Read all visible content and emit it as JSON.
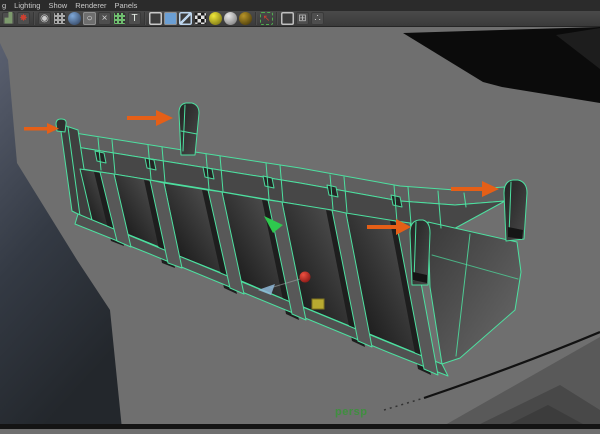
{
  "menu_bar": {
    "items": [
      {
        "label": "g"
      },
      {
        "label": "Lighting"
      },
      {
        "label": "Show"
      },
      {
        "label": "Renderer"
      },
      {
        "label": "Panels"
      }
    ]
  },
  "toolbar": {
    "icons": [
      {
        "name": "partial-toolbar-icon",
        "type": "glyph",
        "glyph": "▟",
        "fg": "#7d9a6d"
      },
      {
        "name": "snap-red-icon",
        "type": "glyph",
        "glyph": "✸",
        "fg": "#cf4030"
      },
      {
        "name": "separator",
        "type": "sep"
      },
      {
        "name": "resolution-gate-eye-icon",
        "type": "glyph",
        "glyph": "◉",
        "fg": "#cccccc"
      },
      {
        "name": "film-gate-icon",
        "type": "grid",
        "fg": "#aaaaaa"
      },
      {
        "name": "camera-sphere-icon",
        "type": "sphere",
        "fg": "#7fa8d8",
        "bg": "#2a3a55"
      },
      {
        "name": "gate-mask-icon",
        "type": "glyph",
        "glyph": "○",
        "fg": "#e0e0e0",
        "active": true
      },
      {
        "name": "field-chart-icon",
        "type": "glyph",
        "glyph": "×",
        "fg": "#d0d0d0"
      },
      {
        "name": "safe-action-icon",
        "type": "grid",
        "fg": "#6fbf6f"
      },
      {
        "name": "safe-title-icon",
        "type": "glyph",
        "glyph": "T",
        "fg": "#e8f0e8"
      },
      {
        "name": "separator",
        "type": "sep"
      },
      {
        "name": "wireframe-mode-icon",
        "type": "wirebox",
        "fg": "#c8c8c8"
      },
      {
        "name": "shaded-mode-icon",
        "type": "box",
        "fg": "#6b9fd4",
        "active": true
      },
      {
        "name": "textured-mode-icon",
        "type": "wirebox2",
        "fg": "#bcd4ec"
      },
      {
        "name": "checker-material-icon",
        "type": "checker"
      },
      {
        "name": "all-lights-icon",
        "type": "sphere",
        "fg": "#f0e83a",
        "bg": "#6a6410"
      },
      {
        "name": "default-light-icon",
        "type": "sphere",
        "fg": "#e8e8e8",
        "bg": "#707070"
      },
      {
        "name": "no-lights-icon",
        "type": "sphere",
        "fg": "#b89428",
        "bg": "#3a2f08"
      },
      {
        "name": "separator",
        "type": "sep"
      },
      {
        "name": "paint-select-icon",
        "type": "dashbox",
        "glyph": "↖",
        "fg": "#d04030"
      },
      {
        "name": "separator",
        "type": "sep"
      },
      {
        "name": "xray-cube-icon",
        "type": "wirebox",
        "fg": "#c0c0c0"
      },
      {
        "name": "xray-joints-cube-icon",
        "type": "glyph",
        "glyph": "⊞",
        "fg": "#c0c0c0"
      },
      {
        "name": "exposure-share-icon",
        "type": "glyph",
        "glyph": "∴",
        "fg": "#c8c8c8"
      }
    ]
  },
  "viewport": {
    "camera_label": "persp",
    "colors": {
      "background": "#6f6f6f",
      "wireframe_selected": "#4de0a0",
      "arrow": "#e55f17",
      "persp_label": "#3f8f3f",
      "silhouette_black": "#0b0b0b",
      "wedge_blue_gray": "#5a6070"
    },
    "annotations": {
      "arrow_count": 4,
      "arrows": [
        {
          "direction": "right",
          "target": "left-end-hinge-knob"
        },
        {
          "direction": "right",
          "target": "second-hinge-knob"
        },
        {
          "direction": "right",
          "target": "middle-hinge-knob"
        },
        {
          "direction": "right",
          "target": "right-end-hinge-knob"
        }
      ]
    },
    "manipulator": {
      "tool": "move",
      "axis_colors": {
        "x": "#e03030",
        "y": "#2ec84e",
        "z": "#8fb9d8",
        "center": "#c8b832"
      }
    }
  }
}
